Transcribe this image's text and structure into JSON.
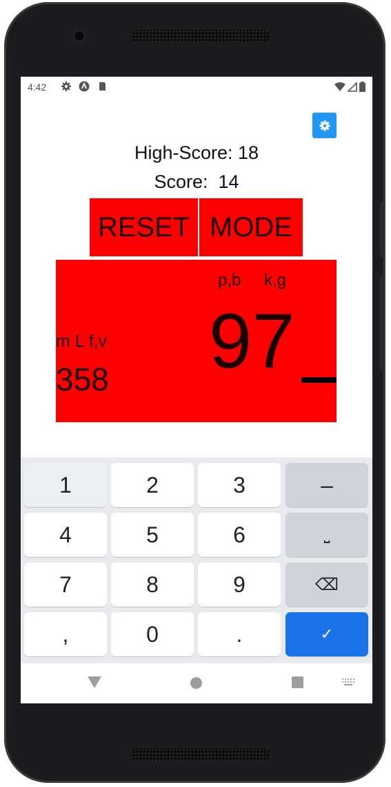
{
  "status": {
    "time": "4:42"
  },
  "app": {
    "high_score_label": "High-Score: 18",
    "score_label": "Score:  14",
    "reset_label": "RESET",
    "mode_label": "MODE",
    "hint_pb": "p,b",
    "hint_kg": "k,g",
    "hint_mlfv": "m L f,v",
    "side_number": "358",
    "main_number": "97",
    "accent_color": "#ff0000"
  },
  "keyboard": {
    "keys": [
      "1",
      "2",
      "3",
      "–",
      "4",
      "5",
      "6",
      "⎵",
      "7",
      "8",
      "9",
      "⌫",
      ",",
      "0",
      ".",
      "✓"
    ]
  }
}
